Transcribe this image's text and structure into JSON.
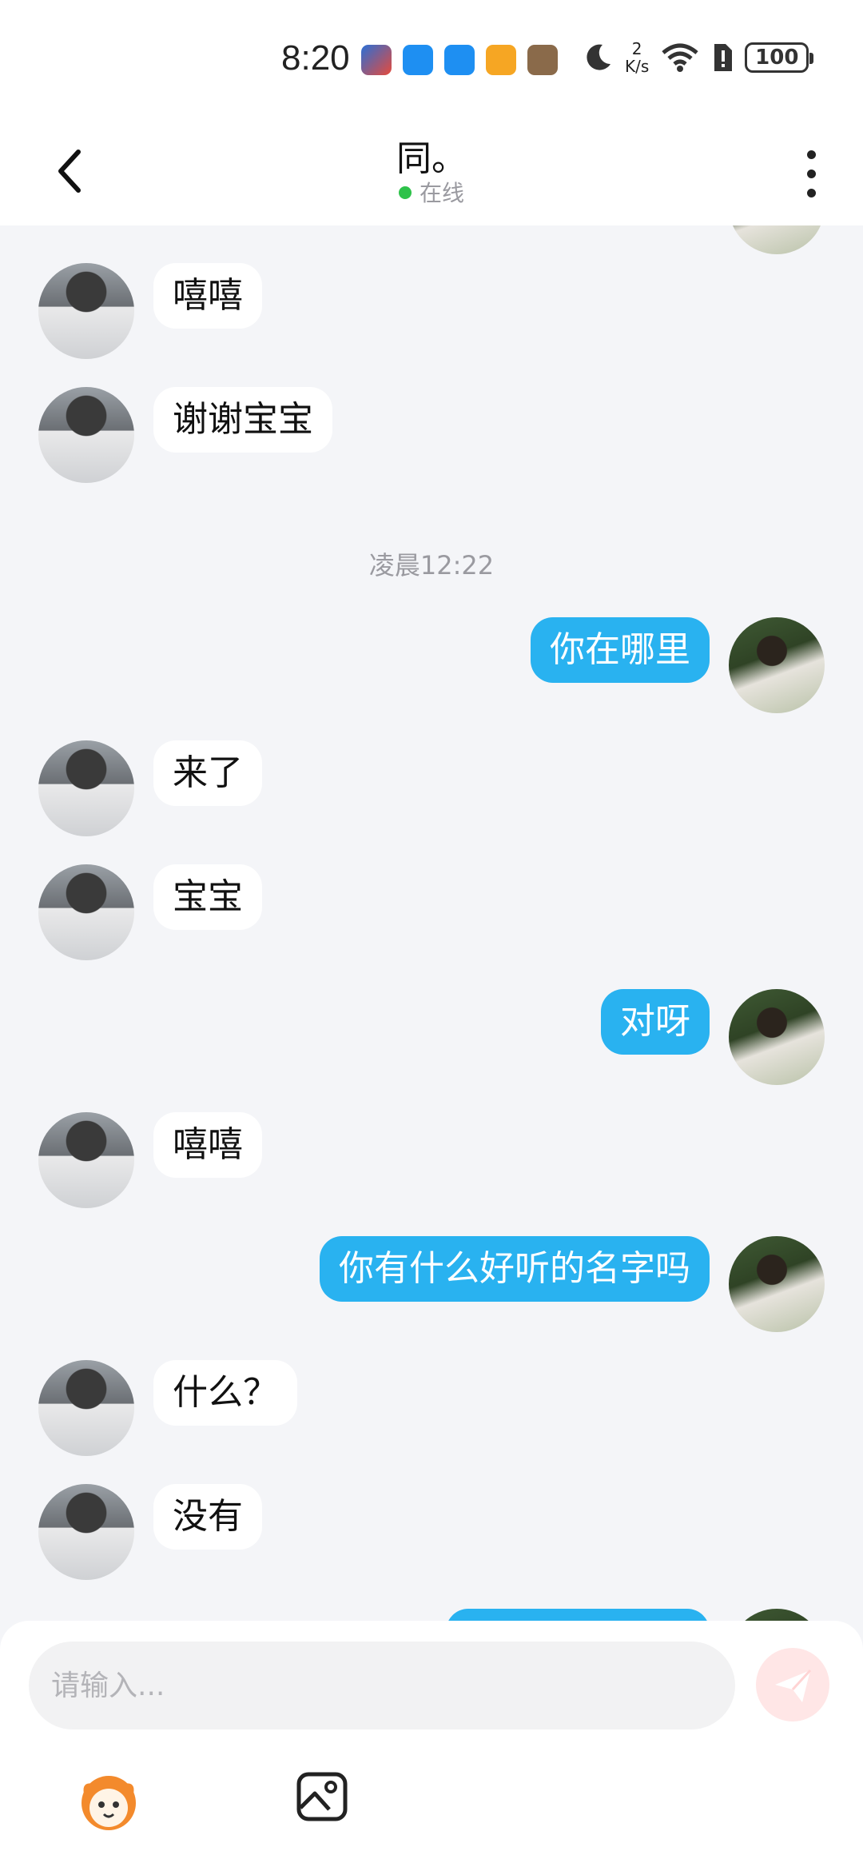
{
  "status_bar": {
    "time": "8:20",
    "network_speed_value": "2",
    "network_speed_unit": "K/s",
    "battery": "100",
    "app_icons": [
      "game-app-icon",
      "cloud-app-icon",
      "cloud-app-icon-2",
      "orange-app-icon",
      "photo-app-icon"
    ]
  },
  "header": {
    "title": "同。",
    "status": "在线",
    "status_color": "#2ec24a"
  },
  "messages": [
    {
      "side": "in",
      "text": "嘻嘻"
    },
    {
      "side": "in",
      "text": "谢谢宝宝"
    },
    {
      "type": "timestamp",
      "text": "凌晨12:22"
    },
    {
      "side": "out",
      "text": "你在哪里"
    },
    {
      "side": "in",
      "text": "来了"
    },
    {
      "side": "in",
      "text": "宝宝"
    },
    {
      "side": "out",
      "text": "对呀"
    },
    {
      "side": "in",
      "text": "嘻嘻"
    },
    {
      "side": "out",
      "text": "你有什么好听的名字吗"
    },
    {
      "side": "in",
      "text": "什么？"
    },
    {
      "side": "in",
      "text": "没有"
    }
  ],
  "composer": {
    "placeholder": "请输入...",
    "accent": "#29b2f0"
  }
}
